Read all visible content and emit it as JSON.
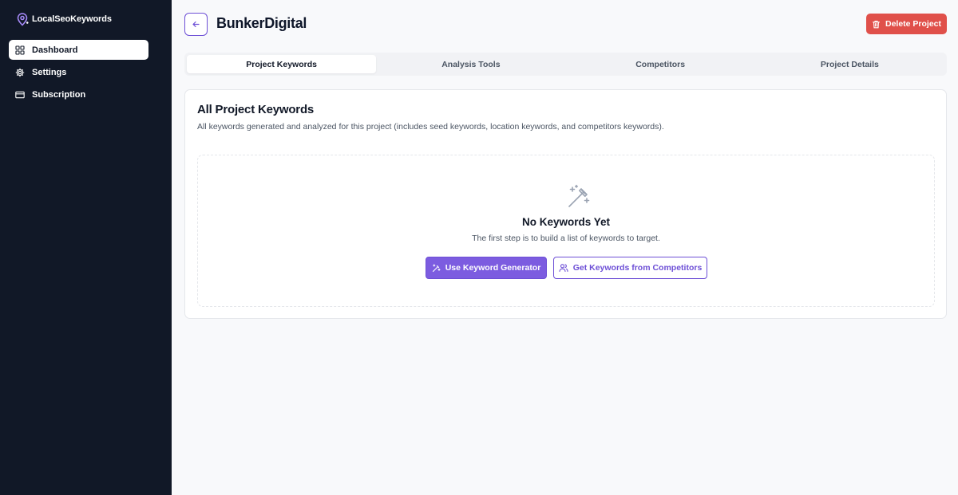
{
  "app": {
    "brand_name": "LocalSeoKeywords"
  },
  "sidebar": {
    "items": [
      {
        "label": "Dashboard",
        "icon": "dashboard-grid-icon",
        "active": true
      },
      {
        "label": "Settings",
        "icon": "gear-icon",
        "active": false
      },
      {
        "label": "Subscription",
        "icon": "credit-card-icon",
        "active": false
      }
    ]
  },
  "header": {
    "project_title": "BunkerDigital",
    "delete_label": "Delete Project"
  },
  "tabs": [
    {
      "label": "Project Keywords",
      "active": true
    },
    {
      "label": "Analysis Tools",
      "active": false
    },
    {
      "label": "Competitors",
      "active": false
    },
    {
      "label": "Project Details",
      "active": false
    }
  ],
  "card": {
    "title": "All Project Keywords",
    "description": "All keywords generated and analyzed for this project (includes seed keywords, location keywords, and competitors keywords).",
    "empty_state": {
      "icon": "magic-wand-icon",
      "title": "No Keywords Yet",
      "subtitle": "The first step is to build a list of keywords to target.",
      "primary_button": "Use Keyword Generator",
      "secondary_button": "Get Keywords from Competitors"
    }
  },
  "colors": {
    "sidebar_bg": "#111827",
    "accent": "#7c5ce0",
    "danger": "#e0504a",
    "page_bg": "#f8f9fb"
  }
}
